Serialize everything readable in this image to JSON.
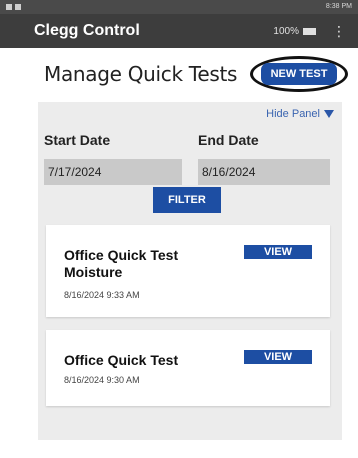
{
  "status_bar": {
    "right_text": "8:38 PM"
  },
  "app": {
    "title": "Clegg Control",
    "battery": "100%",
    "menu_icon": "more-vert-icon"
  },
  "header": {
    "title": "Manage Quick Tests",
    "new_test_label": "NEW TEST"
  },
  "filter_panel": {
    "hide_label": "Hide Panel",
    "start_label": "Start Date",
    "end_label": "End Date",
    "start_value": "7/17/2024",
    "end_value": "8/16/2024",
    "filter_label": "FILTER"
  },
  "tests": [
    {
      "name_line1": "Office Quick Test",
      "name_line2": "Moisture",
      "date": "8/16/2024 9:33 AM",
      "view_label": "VIEW"
    },
    {
      "name_line1": "Office Quick Test",
      "name_line2": "",
      "date": "8/16/2024 9:30 AM",
      "view_label": "VIEW"
    }
  ],
  "colors": {
    "accent": "#1d4ea3",
    "appbar": "#3d3d3d",
    "panel": "#ececec"
  }
}
